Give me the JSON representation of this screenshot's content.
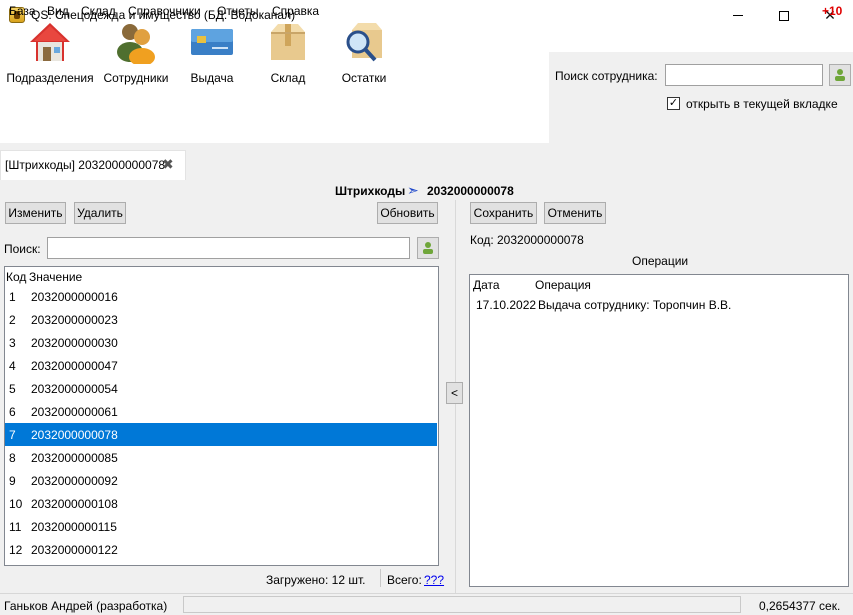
{
  "window": {
    "title": "QS: Спецодежда и имущество (БД: Водоканал)",
    "counter": "+10"
  },
  "menu": [
    "База",
    "Вид",
    "Склад",
    "Справочники",
    "Отчеты",
    "Справка"
  ],
  "toolbar": [
    {
      "label": "Подразделения",
      "icon": "house-icon"
    },
    {
      "label": "Сотрудники",
      "icon": "people-icon"
    },
    {
      "label": "Выдача",
      "icon": "card-icon"
    },
    {
      "label": "Склад",
      "icon": "box-icon"
    },
    {
      "label": "Остатки",
      "icon": "box-search-icon"
    }
  ],
  "employee_search": {
    "label": "Поиск сотрудника:",
    "value": "",
    "open_in_current_tab_label": "открыть в текущей вкладке",
    "open_in_current_tab_checked": true
  },
  "tab": {
    "label": "[Штрихкоды] 2032000000078"
  },
  "header": {
    "title": "Штрихкоды",
    "arrow": "➣",
    "code": "2032000000078"
  },
  "left": {
    "buttons": {
      "edit": "Изменить",
      "delete": "Удалить",
      "refresh": "Обновить"
    },
    "search_label": "Поиск:",
    "search_value": "",
    "columns": [
      "Код",
      "Значение"
    ],
    "rows": [
      {
        "code": "1",
        "value": "2032000000016"
      },
      {
        "code": "2",
        "value": "2032000000023"
      },
      {
        "code": "3",
        "value": "2032000000030"
      },
      {
        "code": "4",
        "value": "2032000000047"
      },
      {
        "code": "5",
        "value": "2032000000054"
      },
      {
        "code": "6",
        "value": "2032000000061"
      },
      {
        "code": "7",
        "value": "2032000000078",
        "selected": true
      },
      {
        "code": "8",
        "value": "2032000000085"
      },
      {
        "code": "9",
        "value": "2032000000092"
      },
      {
        "code": "10",
        "value": "2032000000108"
      },
      {
        "code": "11",
        "value": "2032000000115"
      },
      {
        "code": "12",
        "value": "2032000000122"
      }
    ],
    "loaded_text": "Загружено: 12 шт.",
    "total_label": "Всего:",
    "total_link": "???"
  },
  "splitter": {
    "collapse_glyph": "<"
  },
  "right": {
    "buttons": {
      "save": "Сохранить",
      "cancel": "Отменить"
    },
    "code_label": "Код:",
    "code_value": "2032000000078",
    "operations_title": "Операции",
    "operations_columns": [
      "Дата",
      "Операция"
    ],
    "operations": [
      {
        "date": "17.10.2022",
        "operation": "Выдача сотруднику: Торопчин В.В."
      }
    ]
  },
  "status": {
    "user": "Ганьков Андрей (разработка)",
    "time": "0,2654377 сек."
  },
  "colors": {
    "selection": "#0078d7",
    "counter": "#e00000",
    "link": "#0000ee",
    "arrow": "#1a44c9"
  }
}
